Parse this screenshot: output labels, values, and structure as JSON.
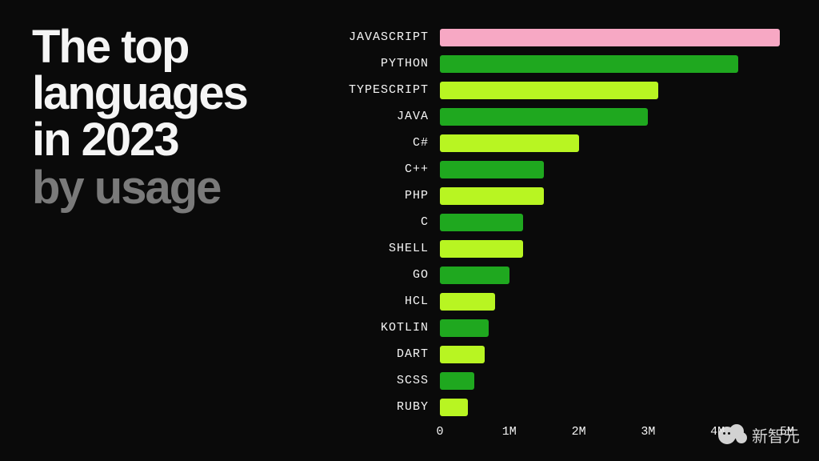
{
  "title": {
    "line1": "The top",
    "line2": "languages",
    "line3": "in 2023",
    "sub": "by usage"
  },
  "colors": {
    "pink": "#f7a8c4",
    "green_dark": "#1fa81f",
    "green_bright": "#b8f522"
  },
  "chart_data": {
    "type": "bar",
    "title": "The top languages in 2023 by usage",
    "xlabel": "",
    "ylabel": "",
    "xlim": [
      0,
      5000000
    ],
    "categories": [
      "JAVASCRIPT",
      "PYTHON",
      "TYPESCRIPT",
      "JAVA",
      "C#",
      "C++",
      "PHP",
      "C",
      "SHELL",
      "GO",
      "HCL",
      "KOTLIN",
      "DART",
      "SCSS",
      "RUBY"
    ],
    "series": [
      {
        "name": "usage",
        "values": [
          4900000,
          4300000,
          3150000,
          3000000,
          2000000,
          1500000,
          1500000,
          1200000,
          1200000,
          1000000,
          800000,
          700000,
          650000,
          500000,
          400000
        ],
        "colors": [
          "pink",
          "green_dark",
          "green_bright",
          "green_dark",
          "green_bright",
          "green_dark",
          "green_bright",
          "green_dark",
          "green_bright",
          "green_dark",
          "green_bright",
          "green_dark",
          "green_bright",
          "green_dark",
          "green_bright"
        ]
      }
    ],
    "ticks": [
      {
        "value": 0,
        "label": "0"
      },
      {
        "value": 1000000,
        "label": "1M"
      },
      {
        "value": 2000000,
        "label": "2M"
      },
      {
        "value": 3000000,
        "label": "3M"
      },
      {
        "value": 4000000,
        "label": "4M"
      },
      {
        "value": 5000000,
        "label": "5M"
      }
    ]
  },
  "watermark": "新智元"
}
